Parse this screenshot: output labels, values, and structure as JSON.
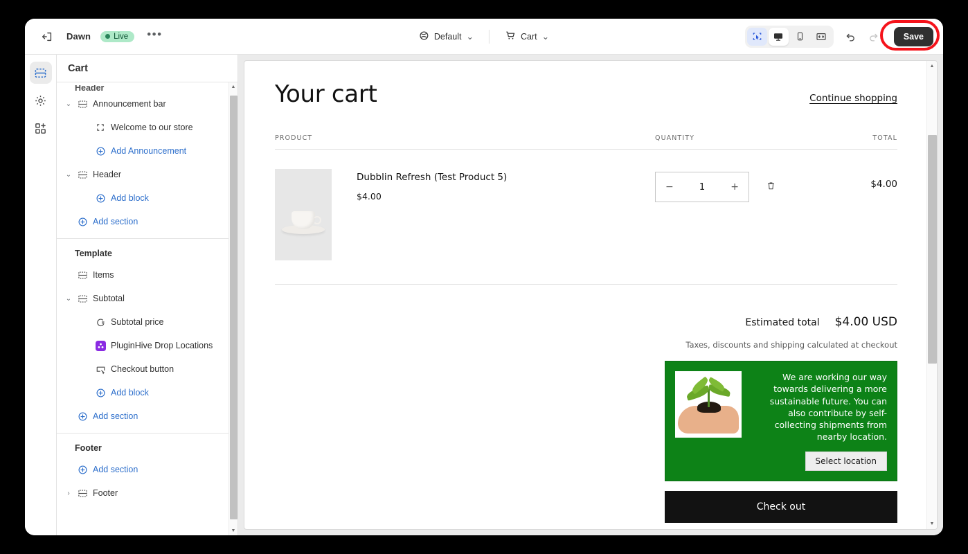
{
  "topbar": {
    "exit_icon": "exit-icon",
    "theme_name": "Dawn",
    "status_badge": "Live",
    "more_label": "•••",
    "locale_selector": {
      "icon": "globe-icon",
      "label": "Default",
      "chevron": "⌄"
    },
    "page_selector": {
      "icon": "cart-icon",
      "label": "Cart",
      "chevron": "⌄"
    },
    "view_buttons": [
      {
        "name": "inspector-tool",
        "state": "active"
      },
      {
        "name": "desktop-view",
        "state": "selected"
      },
      {
        "name": "mobile-view",
        "state": "default"
      },
      {
        "name": "fullscreen-view",
        "state": "default"
      }
    ],
    "undo_label": "undo-icon",
    "redo_label": "redo-icon",
    "save_label": "Save",
    "annotation_color": "#f5131b",
    "save_bg": "#303030",
    "live_badge_bg": "#aee9c8",
    "live_badge_color": "#0c5132"
  },
  "rail": {
    "items": [
      {
        "name": "sections-tab",
        "icon": "sections-icon",
        "active": true
      },
      {
        "name": "theme-settings-tab",
        "icon": "gear-icon",
        "active": false
      },
      {
        "name": "apps-tab",
        "icon": "apps-icon",
        "active": false
      }
    ]
  },
  "panel": {
    "title": "Cart",
    "clipped_group": "Header",
    "groups": [
      {
        "label": "Header",
        "clipped": true,
        "rows": [
          {
            "label": "Announcement bar",
            "icon": "section-icon",
            "chevron": "⌄",
            "level": 1,
            "type": "section"
          },
          {
            "label": "Welcome to our store",
            "icon": "block-icon",
            "chevron": "",
            "level": 2,
            "type": "block"
          },
          {
            "label": "Add Announcement",
            "icon": "circle-plus-icon",
            "chevron": "",
            "level": 2,
            "type": "add"
          },
          {
            "label": "Header",
            "icon": "section-icon",
            "chevron": "⌄",
            "level": 1,
            "type": "section"
          },
          {
            "label": "Add block",
            "icon": "circle-plus-icon",
            "chevron": "",
            "level": 2,
            "type": "add"
          },
          {
            "label": "Add section",
            "icon": "circle-plus-icon",
            "chevron": "",
            "level": 1,
            "type": "add"
          }
        ]
      },
      {
        "label": "Template",
        "clipped": false,
        "rows": [
          {
            "label": "Items",
            "icon": "items-icon",
            "chevron": "",
            "level": 1,
            "type": "section"
          },
          {
            "label": "Subtotal",
            "icon": "subtotal-icon",
            "chevron": "⌄",
            "level": 1,
            "type": "section"
          },
          {
            "label": "Subtotal price",
            "icon": "price-icon",
            "chevron": "",
            "level": 2,
            "type": "block"
          },
          {
            "label": "PluginHive Drop Locations",
            "icon": "pluginhive-app-icon",
            "chevron": "",
            "level": 2,
            "type": "app"
          },
          {
            "label": "Checkout button",
            "icon": "button-icon",
            "chevron": "",
            "level": 2,
            "type": "block"
          },
          {
            "label": "Add block",
            "icon": "circle-plus-icon",
            "chevron": "",
            "level": 2,
            "type": "add"
          },
          {
            "label": "Add section",
            "icon": "circle-plus-icon",
            "chevron": "",
            "level": 1,
            "type": "add"
          }
        ]
      },
      {
        "label": "Footer",
        "clipped": false,
        "rows": [
          {
            "label": "Add section",
            "icon": "circle-plus-icon",
            "chevron": "",
            "level": 1,
            "type": "add"
          },
          {
            "label": "Footer",
            "icon": "subtotal-icon",
            "chevron": "›",
            "level": 1,
            "type": "section"
          }
        ]
      }
    ],
    "app_icon_color": "#8a2be2"
  },
  "preview": {
    "cart_title": "Your cart",
    "continue_link": "Continue shopping",
    "columns": {
      "product": "PRODUCT",
      "quantity": "QUANTITY",
      "total": "TOTAL"
    },
    "items": [
      {
        "name": "Dubblin Refresh (Test Product 5)",
        "price": "$4.00",
        "quantity": "1",
        "decrement": "−",
        "increment": "+",
        "remove_icon": "trash-icon",
        "line_total": "$4.00",
        "thumbnail": "cup-and-saucer-photo"
      }
    ],
    "estimated_total_label": "Estimated total",
    "estimated_total_value": "$4.00 USD",
    "tax_note": "Taxes, discounts and shipping calculated at checkout",
    "banner": {
      "image": "hand-holding-seedling-photo",
      "text": "We are working our way towards delivering a more sustainable future. You can also contribute by self-collecting shipments from nearby location.",
      "button_label": "Select location",
      "bg_color": "#0d8217"
    },
    "checkout_label": "Check out",
    "checkout_bg": "#121212"
  }
}
